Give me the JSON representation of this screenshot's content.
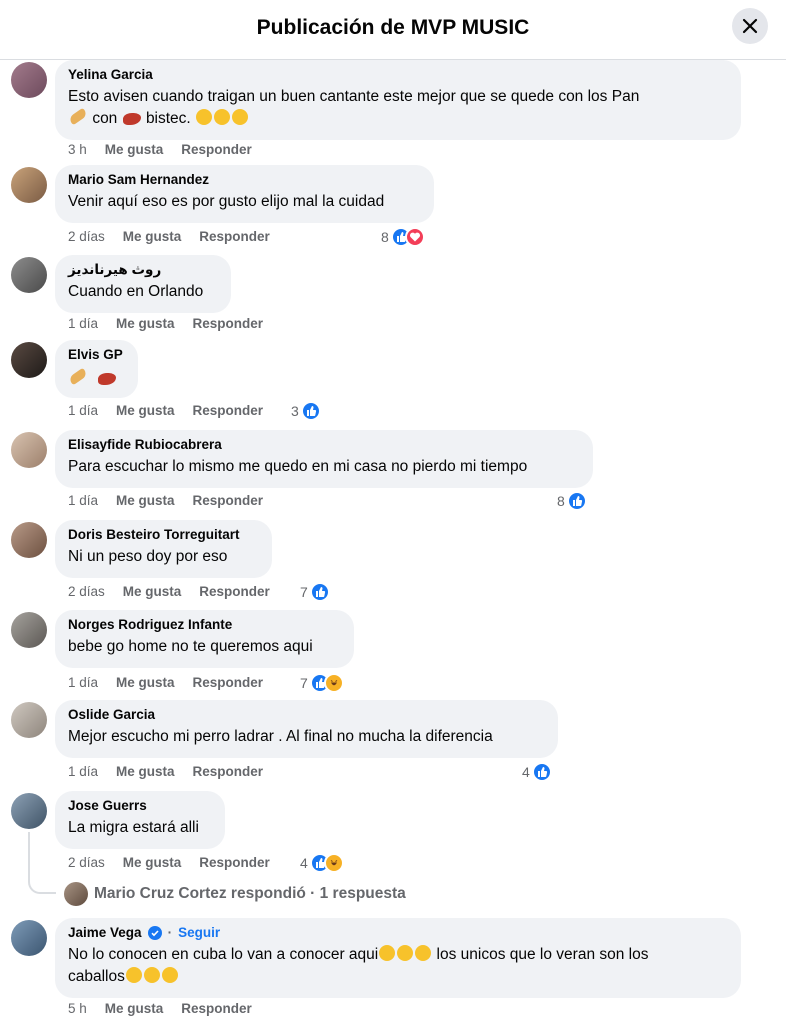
{
  "header": {
    "title": "Publicación de MVP MUSIC"
  },
  "comments": [
    {
      "author": "Yelina Garcia",
      "text": "Esto avisen cuando traigan un buen cantante este mejor que se quede con los Pan",
      "text2a": "con",
      "text2b": "bistec.",
      "time": "3 h",
      "like": "Me gusta",
      "reply": "Responder",
      "count": ""
    },
    {
      "author": "Mario Sam Hernandez",
      "text": "Venir aquí eso es por gusto elijo mal la cuidad",
      "time": "2 días",
      "like": "Me gusta",
      "reply": "Responder",
      "count": "8"
    },
    {
      "author": "روث هيرنانديز",
      "text": "Cuando en Orlando",
      "time": "1 día",
      "like": "Me gusta",
      "reply": "Responder",
      "count": ""
    },
    {
      "author": "Elvis GP",
      "text": "",
      "time": "1 día",
      "like": "Me gusta",
      "reply": "Responder",
      "count": "3"
    },
    {
      "author": "Elisayfide Rubiocabrera",
      "text": "Para escuchar lo mismo me quedo en mi casa no pierdo mi tiempo",
      "time": "1 día",
      "like": "Me gusta",
      "reply": "Responder",
      "count": "8"
    },
    {
      "author": "Doris Besteiro Torreguitart",
      "text": "Ni un peso doy por eso",
      "time": "2 días",
      "like": "Me gusta",
      "reply": "Responder",
      "count": "7"
    },
    {
      "author": "Norges Rodriguez Infante",
      "text": "bebe go home no te queremos aqui",
      "time": "1 día",
      "like": "Me gusta",
      "reply": "Responder",
      "count": "7"
    },
    {
      "author": "Oslide Garcia",
      "text": "Mejor escucho mi perro ladrar . Al final no mucha la diferencia",
      "time": "1 día",
      "like": "Me gusta",
      "reply": "Responder",
      "count": "4"
    },
    {
      "author": "Jose Guerrs",
      "text": "La migra estará alli",
      "time": "2 días",
      "like": "Me gusta",
      "reply": "Responder",
      "count": "4"
    },
    {
      "author": "Jaime Vega",
      "follow": "Seguir",
      "text": "No lo conocen en cuba lo van a conocer aqui",
      "text_b": "los unicos que lo veran son los",
      "text2": "caballos",
      "time": "5 h",
      "like": "Me gusta",
      "reply": "Responder",
      "count": ""
    }
  ],
  "reply_summary": {
    "text": "Mario Cruz Cortez respondió · 1 respuesta"
  },
  "colors": {
    "like": "#1877f2",
    "love": "#f33e58",
    "haha": "#f7b125",
    "bubble": "#f0f2f5",
    "meta": "#65676b"
  }
}
